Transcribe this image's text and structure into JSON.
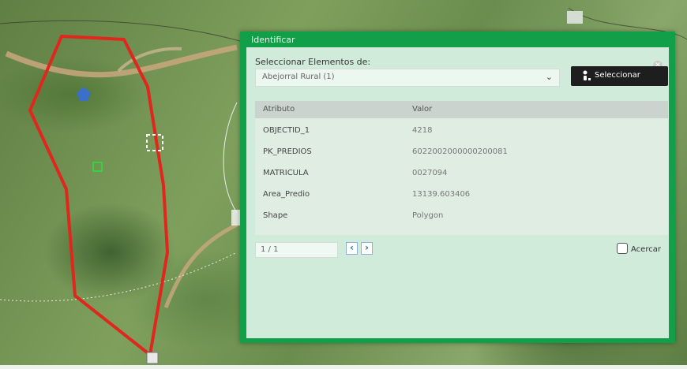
{
  "identify_panel": {
    "title": "Identificar",
    "select_label": "Seleccionar Elementos de:",
    "layer_value": "Abejorral Rural (1)",
    "select_button_label": "Seleccionar",
    "table": {
      "headers": [
        "Atributo",
        "Valor"
      ],
      "rows": [
        {
          "attribute": "OBJECTID_1",
          "value": "4218"
        },
        {
          "attribute": "PK_PREDIOS",
          "value": "6022002000000200081"
        },
        {
          "attribute": "MATRICULA",
          "value": "0027094"
        },
        {
          "attribute": "Area_Predio",
          "value": "13139.603406"
        },
        {
          "attribute": "Shape",
          "value": "Polygon"
        }
      ]
    },
    "pager": "1 / 1",
    "prev_icon": "chevron-left-icon",
    "next_icon": "chevron-right-icon",
    "zoom_label": "Acercar",
    "zoom_checked": false
  },
  "map": {
    "parcel_outline_color": "#e0261d",
    "panel_color": "#119f49"
  }
}
